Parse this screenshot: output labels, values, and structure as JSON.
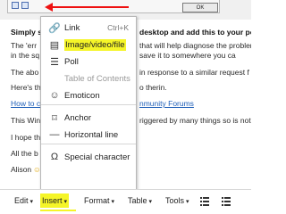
{
  "top_strip": {
    "ok_label": "OK"
  },
  "document": {
    "lines": [
      {
        "text": "Simply s",
        "style": "bold"
      },
      {
        "text": "The 'err",
        "style": "normal"
      },
      {
        "text": "in the sq",
        "style": "normal"
      },
      {
        "text": "The abo",
        "style": "normal"
      },
      {
        "text": "Here's th",
        "style": "normal"
      },
      {
        "text": "How to c",
        "style": "link"
      },
      {
        "text": "This Win",
        "style": "normal"
      },
      {
        "text": "I hope th",
        "style": "normal"
      },
      {
        "text": "All the b",
        "style": "normal"
      },
      {
        "text": "Alison",
        "style": "normal"
      }
    ],
    "right_fragments": [
      {
        "text": "desktop and add this to your po",
        "style": "bold"
      },
      {
        "text": "that will help diagnose the problem",
        "style": "normal"
      },
      {
        "text": "save it to somewhere you ca",
        "style": "normal"
      },
      {
        "text": "in response to a similar request f",
        "style": "normal"
      },
      {
        "text": "o therin.",
        "style": "normal"
      },
      {
        "text": "nmunity Forums",
        "style": "link"
      },
      {
        "text": "riggered by many things so is not s",
        "style": "normal"
      }
    ]
  },
  "menu": {
    "items": [
      {
        "name": "link",
        "label": "Link",
        "shortcut": "Ctrl+K",
        "icon": "link-icon",
        "glyph": "🔗",
        "disabled": false,
        "highlight": false
      },
      {
        "name": "image-video-file",
        "label": "Image/video/file",
        "shortcut": "",
        "icon": "image-video-icon",
        "glyph": "▤",
        "disabled": false,
        "highlight": true
      },
      {
        "name": "poll",
        "label": "Poll",
        "shortcut": "",
        "icon": "poll-icon",
        "glyph": "☰",
        "disabled": false,
        "highlight": false
      },
      {
        "name": "table-of-contents",
        "label": "Table of Contents",
        "shortcut": "",
        "icon": "",
        "glyph": "",
        "disabled": true,
        "highlight": false
      },
      {
        "name": "emoticon",
        "label": "Emoticon",
        "shortcut": "",
        "icon": "emoticon-icon",
        "glyph": "☺",
        "disabled": false,
        "highlight": false
      },
      {
        "name": "anchor",
        "label": "Anchor",
        "shortcut": "",
        "icon": "bookmark-icon",
        "glyph": "⌑",
        "disabled": false,
        "highlight": false
      },
      {
        "name": "horizontal-line",
        "label": "Horizontal line",
        "shortcut": "",
        "icon": "horizontal-line-icon",
        "glyph": "—",
        "disabled": false,
        "highlight": false
      },
      {
        "name": "special-character",
        "label": "Special character",
        "shortcut": "",
        "icon": "omega-icon",
        "glyph": "Ω",
        "disabled": false,
        "highlight": false
      }
    ]
  },
  "toolbar": {
    "edit_label": "Edit",
    "insert_label": "Insert",
    "format_label": "Format",
    "table_label": "Table",
    "tools_label": "Tools",
    "caret": "▾"
  },
  "colors": {
    "highlight": "#f5f528",
    "arrow": "#ee1111",
    "link": "#1f5fb8"
  }
}
